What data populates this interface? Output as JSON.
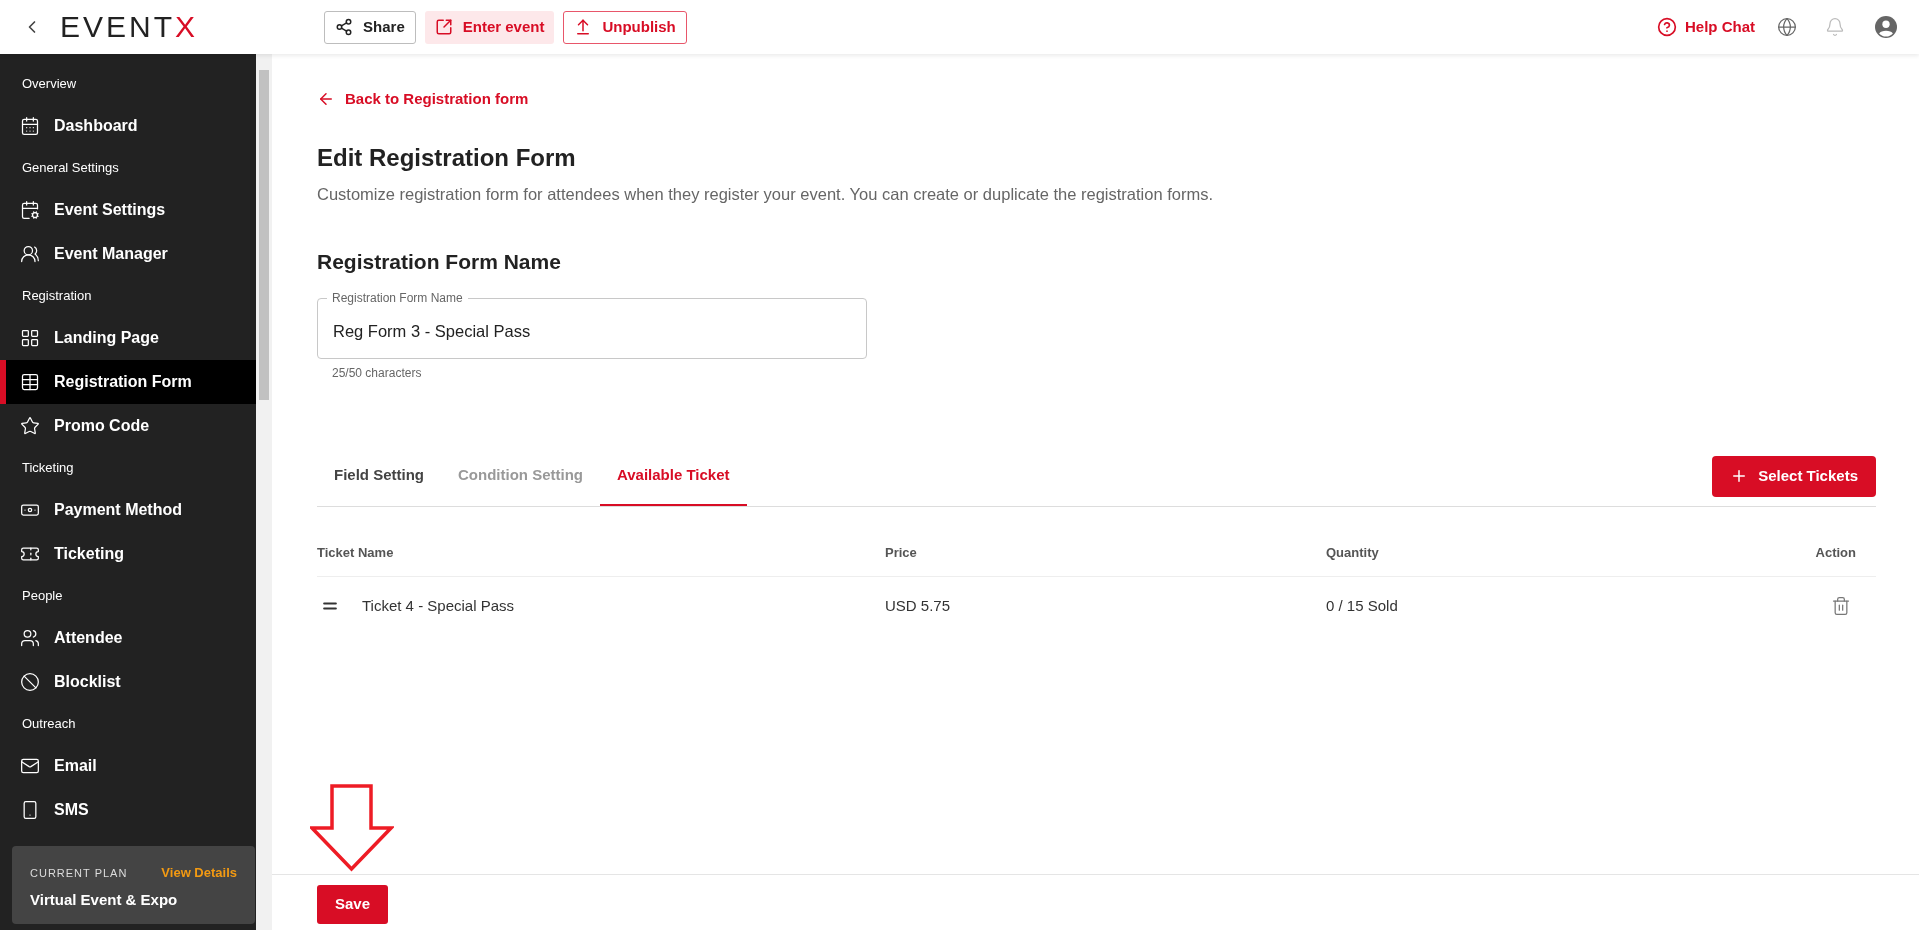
{
  "topbar": {
    "logo": {
      "main": "EVENT",
      "accent": "X"
    },
    "actions": [
      {
        "label": "Share",
        "kind": "outline"
      },
      {
        "label": "Enter event",
        "kind": "tinted"
      },
      {
        "label": "Unpublish",
        "kind": "danger-outline"
      }
    ],
    "help": "Help Chat"
  },
  "sidebar": {
    "sections": [
      {
        "label": "Overview",
        "items": [
          {
            "label": "Dashboard",
            "selected": false
          }
        ]
      },
      {
        "label": "General Settings",
        "items": [
          {
            "label": "Event Settings",
            "selected": false
          },
          {
            "label": "Event Manager",
            "selected": false
          }
        ]
      },
      {
        "label": "Registration",
        "items": [
          {
            "label": "Landing Page",
            "selected": false
          },
          {
            "label": "Registration Form",
            "selected": true
          },
          {
            "label": "Promo Code",
            "selected": false
          }
        ]
      },
      {
        "label": "Ticketing",
        "items": [
          {
            "label": "Payment Method",
            "selected": false
          },
          {
            "label": "Ticketing",
            "selected": false
          }
        ]
      },
      {
        "label": "People",
        "items": [
          {
            "label": "Attendee",
            "selected": false
          },
          {
            "label": "Blocklist",
            "selected": false
          }
        ]
      },
      {
        "label": "Outreach",
        "items": [
          {
            "label": "Email",
            "selected": false
          },
          {
            "label": "SMS",
            "selected": false
          }
        ]
      }
    ],
    "plan": {
      "caption": "CURRENT PLAN",
      "link": "View Details",
      "name": "Virtual Event & Expo"
    }
  },
  "page": {
    "back": "Back to Registration form",
    "title": "Edit Registration Form",
    "description": "Customize registration form for attendees when they register your event. You can create or duplicate the registration forms.",
    "section_title": "Registration Form Name",
    "field": {
      "label": "Registration Form Name",
      "value": "Reg Form 3 - Special Pass",
      "helper": "25/50 characters"
    },
    "tabs": [
      {
        "label": "Field Setting",
        "selected": false,
        "disabled": false
      },
      {
        "label": "Condition Setting",
        "selected": false,
        "disabled": true
      },
      {
        "label": "Available Ticket",
        "selected": true,
        "disabled": false
      }
    ],
    "add_button": "Select Tickets",
    "table": {
      "columns": [
        "Ticket Name",
        "Price",
        "Quantity",
        "Action"
      ],
      "rows": [
        {
          "name": "Ticket 4 - Special Pass",
          "price": "USD 5.75",
          "quantity": "0 / 15 Sold"
        }
      ]
    },
    "save": "Save"
  }
}
